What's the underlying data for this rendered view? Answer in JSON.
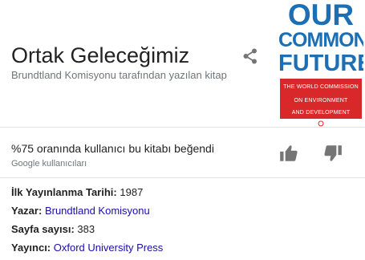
{
  "book": {
    "title": "Ortak Geleceğimiz",
    "subtitle": "Brundtland Komisyonu tarafından yazılan kitap"
  },
  "cover": {
    "line1": "OUR",
    "line2": "COMMON",
    "line3": "FUTURE",
    "band_line1": "THE WORLD COMMISSION",
    "band_line2": "ON ENVIRONMENT",
    "band_line3": "AND DEVELOPMENT",
    "brand_color": "#1c6fb5",
    "band_color": "#d8282a"
  },
  "rating": {
    "text": "%75 oranında kullanıcı bu kitabı beğendi",
    "source": "Google kullanıcıları",
    "like_icon": "thumb-up-icon",
    "dislike_icon": "thumb-down-icon"
  },
  "share_icon": "share-icon",
  "facts": [
    {
      "label": "İlk Yayınlanma Tarihi:",
      "value": "1987"
    },
    {
      "label": "Yazar:",
      "value": "Brundtland Komisyonu"
    },
    {
      "label": "Sayfa sayısı:",
      "value": "383"
    },
    {
      "label": "Yayıncı:",
      "value": "Oxford University Press"
    }
  ],
  "colors": {
    "link": "#1a0dab",
    "secondary_text": "#70757a",
    "icon": "#757575"
  }
}
